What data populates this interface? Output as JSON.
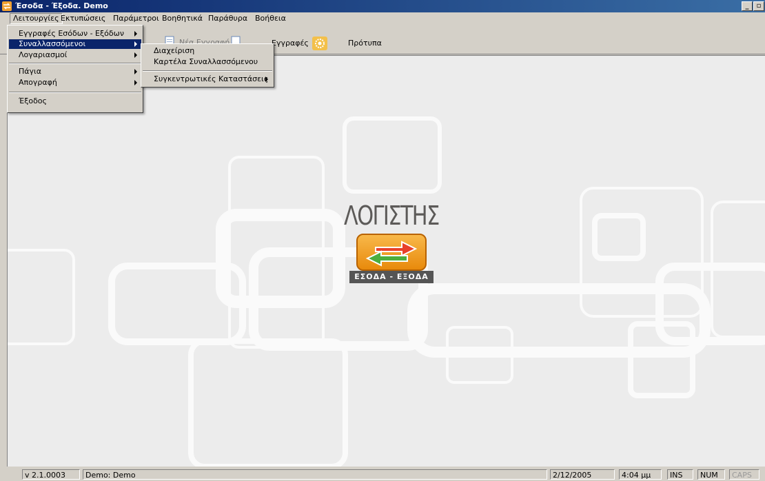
{
  "window": {
    "title": "Έσοδα - Έξοδα. Demo"
  },
  "menubar": [
    "Λειτουργίες",
    "Εκτυπώσεις",
    "Παράμετροι",
    "Βοηθητικά",
    "Παράθυρα",
    "Βοήθεια"
  ],
  "toolbar": {
    "partial_label": "Νέα Εγγραφή",
    "records_label": "Εγγραφές",
    "templates_label": "Πρότυπα"
  },
  "main_menu": {
    "items": [
      "Εγγραφές Εσόδων - Εξόδων",
      "Συναλλασσόμενοι",
      "Λογαριασμοί",
      "Πάγια",
      "Απογραφή",
      "Έξοδος"
    ]
  },
  "submenu": {
    "items": [
      "Διαχείριση",
      "Καρτέλα Συναλλασσόμενου",
      "Συγκεντρωτικές Καταστάσεις"
    ]
  },
  "logo": {
    "title": "ΛΟΓΙΣΤΗΣ",
    "banner": "ΕΣΟΔΑ - ΕΞΟΔΑ"
  },
  "status": {
    "version": "v 2.1.0003",
    "company": "Demo: Demo",
    "date": "2/12/2005",
    "time": "4:04 μμ",
    "ins": "INS",
    "num": "NUM",
    "caps": "CAPS"
  },
  "colors": {
    "title_bar": "#0a246a",
    "selection": "#0a246a",
    "workspace": "#ececec",
    "logo_orange": "#f0a030"
  }
}
